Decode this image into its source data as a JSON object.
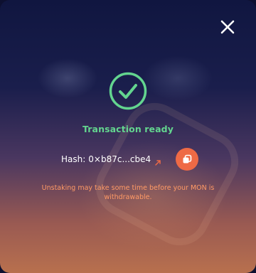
{
  "modal": {
    "title": "Transaction ready",
    "hash_label": "Hash:",
    "hash_value": "0×b87c...cbe4",
    "note": "Unstaking may take some time before your MON is withdrawable."
  },
  "colors": {
    "success": "#63d58f",
    "accent": "#ee6a45",
    "note_text": "#ff9a66"
  },
  "icons": {
    "close": "close-icon",
    "status": "check-circle-icon",
    "link": "external-link-icon",
    "copy": "copy-icon"
  }
}
